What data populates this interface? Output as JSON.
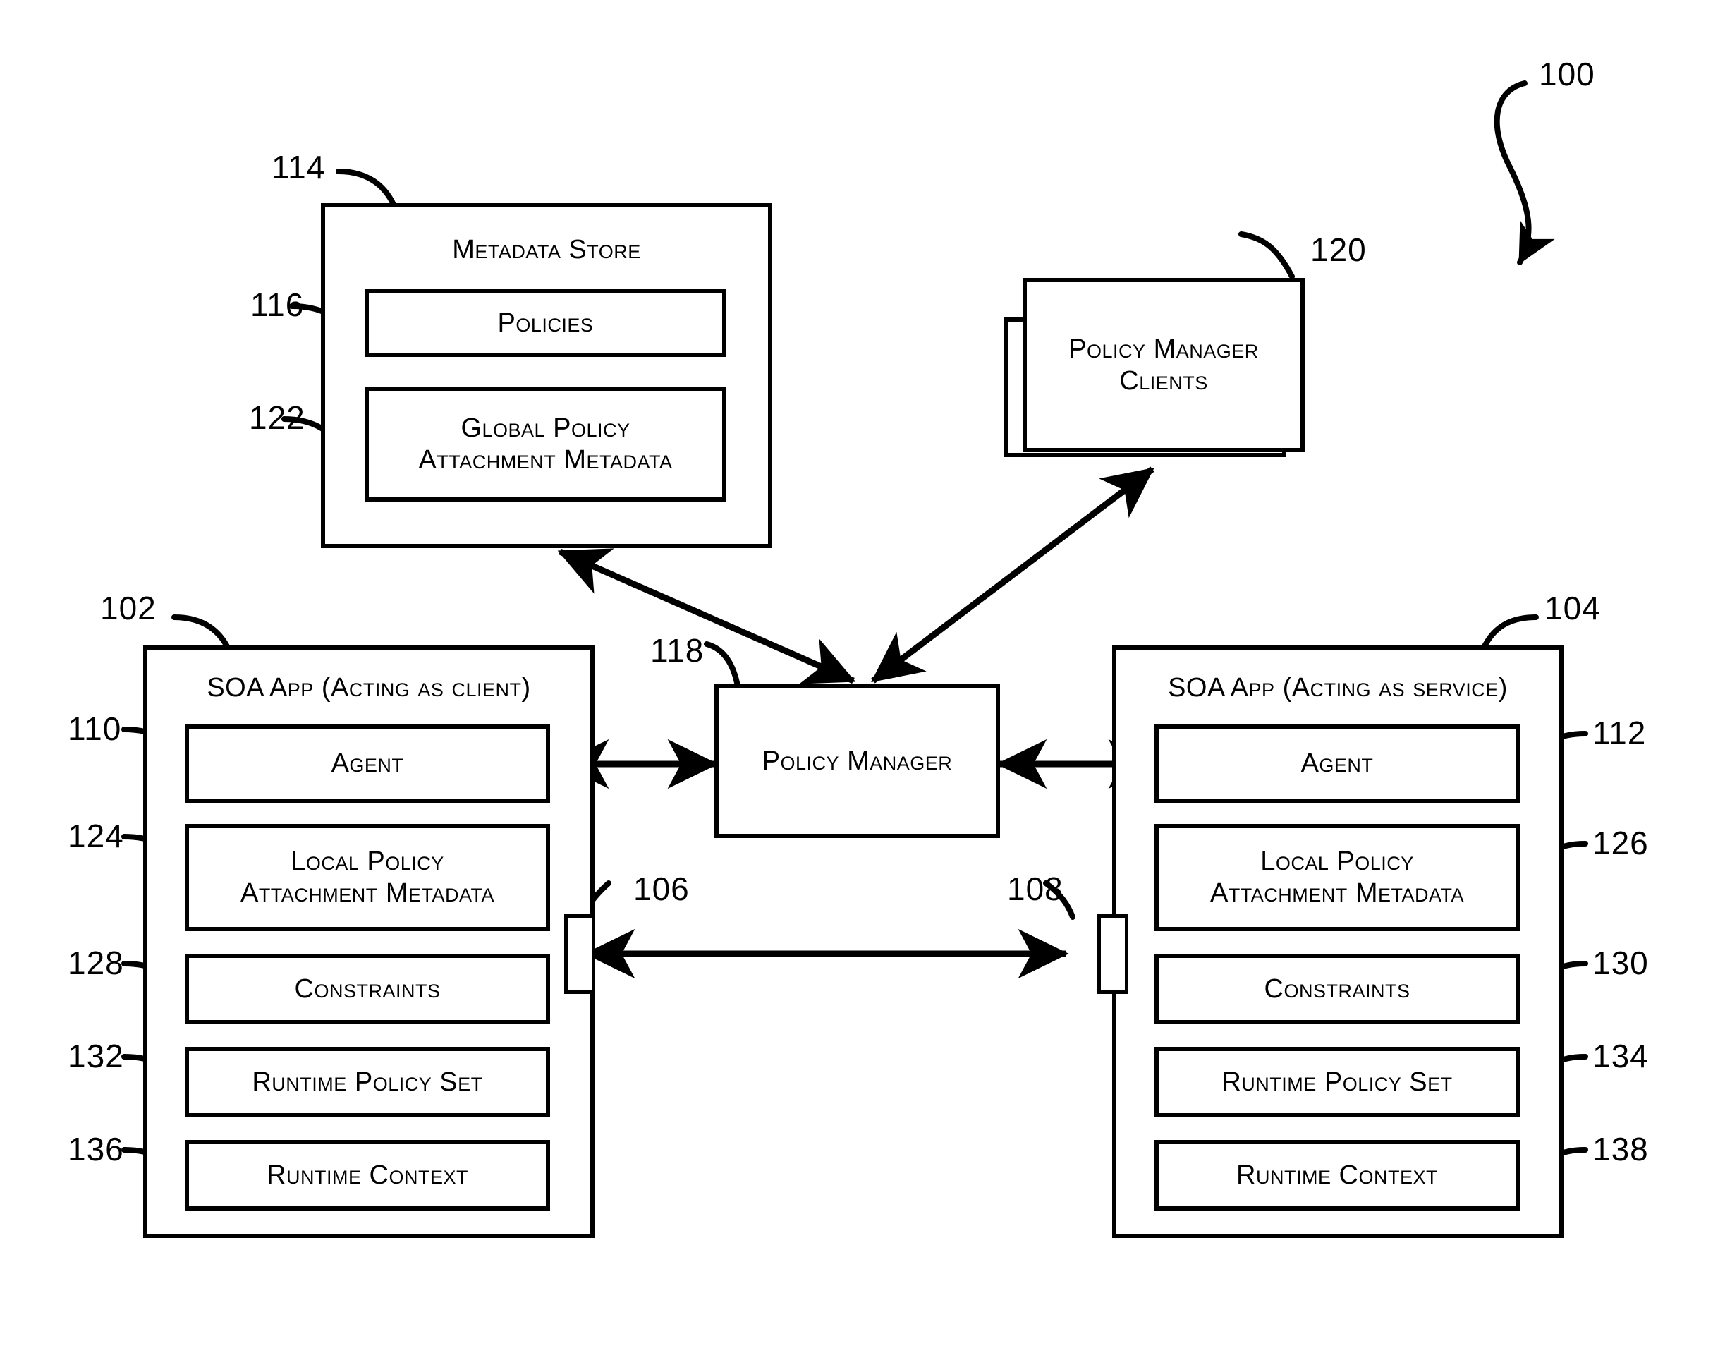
{
  "figure": {
    "number": "100",
    "type": "patent-block-diagram"
  },
  "metadata_store": {
    "ref": "114",
    "title": "Metadata Store",
    "children": [
      {
        "ref": "116",
        "label": "Policies"
      },
      {
        "ref": "122",
        "label": "Global Policy Attachment Metadata",
        "line1": "Global Policy",
        "line2": "Attachment Metadata"
      }
    ]
  },
  "policy_manager_clients": {
    "ref": "120",
    "line1": "Policy Manager",
    "line2": "Clients"
  },
  "policy_manager": {
    "ref": "118",
    "label": "Policy Manager"
  },
  "soa_client": {
    "ref": "102",
    "title": "SOA App (Acting as client)",
    "port": {
      "ref": "106"
    },
    "children": [
      {
        "ref": "110",
        "label": "Agent"
      },
      {
        "ref": "124",
        "label": "Local Policy Attachment Metadata",
        "line1": "Local Policy",
        "line2": "Attachment Metadata"
      },
      {
        "ref": "128",
        "label": "Constraints"
      },
      {
        "ref": "132",
        "label": "Runtime Policy Set"
      },
      {
        "ref": "136",
        "label": "Runtime Context"
      }
    ]
  },
  "soa_service": {
    "ref": "104",
    "title": "SOA App (Acting as service)",
    "port": {
      "ref": "108"
    },
    "children": [
      {
        "ref": "112",
        "label": "Agent"
      },
      {
        "ref": "126",
        "label": "Local Policy Attachment Metadata",
        "line1": "Local Policy",
        "line2": "Attachment Metadata"
      },
      {
        "ref": "130",
        "label": "Constraints"
      },
      {
        "ref": "134",
        "label": "Runtime Policy Set"
      },
      {
        "ref": "138",
        "label": "Runtime Context"
      }
    ]
  },
  "colors": {
    "stroke": "#000000",
    "background": "#ffffff"
  }
}
